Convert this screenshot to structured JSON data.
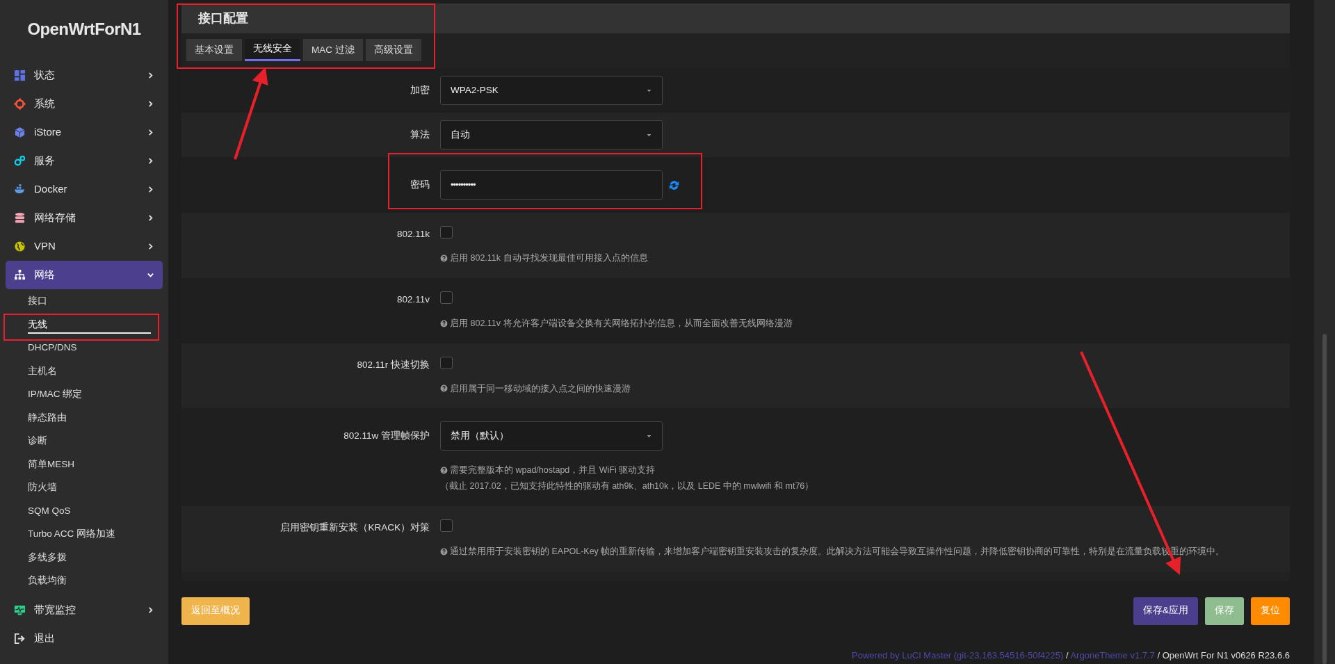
{
  "logo": "OpenWrtForN1",
  "sidebar": {
    "items": [
      {
        "kind": "menu",
        "label": "状态",
        "expanded": false,
        "selected": false
      },
      {
        "kind": "menu",
        "label": "系统",
        "expanded": false,
        "selected": false
      },
      {
        "kind": "menu",
        "label": "iStore",
        "expanded": false,
        "selected": false
      },
      {
        "kind": "menu",
        "label": "服务",
        "expanded": false,
        "selected": false
      },
      {
        "kind": "menu",
        "label": "Docker",
        "expanded": false,
        "selected": false
      },
      {
        "kind": "menu",
        "label": "网络存储",
        "expanded": false,
        "selected": false
      },
      {
        "kind": "menu",
        "label": "VPN",
        "expanded": false,
        "selected": false
      },
      {
        "kind": "menu",
        "label": "网络",
        "expanded": true,
        "selected": true,
        "children": [
          {
            "label": "接口",
            "selected": false
          },
          {
            "label": "无线",
            "selected": true
          },
          {
            "label": "DHCP/DNS",
            "selected": false
          },
          {
            "label": "主机名",
            "selected": false
          },
          {
            "label": "IP/MAC 绑定",
            "selected": false
          },
          {
            "label": "静态路由",
            "selected": false
          },
          {
            "label": "诊断",
            "selected": false
          },
          {
            "label": "简单MESH",
            "selected": false
          },
          {
            "label": "防火墙",
            "selected": false
          },
          {
            "label": "SQM QoS",
            "selected": false
          },
          {
            "label": "Turbo ACC 网络加速",
            "selected": false
          },
          {
            "label": "多线多拨",
            "selected": false
          },
          {
            "label": "负载均衡",
            "selected": false
          }
        ]
      },
      {
        "kind": "menu",
        "label": "带宽监控",
        "expanded": false,
        "selected": false
      },
      {
        "kind": "link",
        "label": "退出"
      }
    ]
  },
  "section": {
    "title": "接口配置",
    "tabs": [
      {
        "label": "基本设置",
        "selected": false
      },
      {
        "label": "无线安全",
        "selected": true
      },
      {
        "label": "MAC 过滤",
        "selected": false
      },
      {
        "label": "高级设置",
        "selected": false
      }
    ],
    "rows": [
      {
        "kind": "select",
        "label": "加密",
        "value": "WPA2-PSK"
      },
      {
        "kind": "select",
        "label": "算法",
        "value": "自动"
      },
      {
        "kind": "password",
        "label": "密码",
        "value": "••••••••••"
      },
      {
        "kind": "checkbox",
        "label": "802.11k",
        "checked": false,
        "help": [
          "启用 802.11k 自动寻找发现最佳可用接入点的信息"
        ]
      },
      {
        "kind": "checkbox",
        "label": "802.11v",
        "checked": false,
        "help": [
          "启用 802.11v 将允许客户端设备交换有关网络拓扑的信息，从而全面改善无线网络漫游"
        ]
      },
      {
        "kind": "checkbox",
        "label": "802.11r 快速切换",
        "checked": false,
        "help": [
          "启用属于同一移动域的接入点之间的快速漫游"
        ]
      },
      {
        "kind": "select",
        "label": "802.11w 管理帧保护",
        "value": "禁用（默认）",
        "help": [
          "需要完整版本的 wpad/hostapd，并且 WiFi 驱动支持",
          "（截止 2017.02，已知支持此特性的驱动有 ath9k、ath10k，以及 LEDE 中的 mwlwifi 和 mt76）"
        ]
      },
      {
        "kind": "checkbox",
        "label": "启用密钥重新安装（KRACK）对策",
        "checked": false,
        "help": [
          "通过禁用用于安装密钥的 EAPOL-Key 帧的重新传输，来增加客户端密钥重安装攻击的复杂度。此解决方法可能会导致互操作性问题，并降低密钥协商的可靠性，特别是在流量负载较重的环境中。"
        ]
      }
    ]
  },
  "buttons": [
    {
      "kind": "back",
      "label": "返回至概况"
    },
    {
      "kind": "apply",
      "label": "保存&应用"
    },
    {
      "kind": "save",
      "label": "保存"
    },
    {
      "kind": "reset",
      "label": "复位"
    }
  ],
  "footer": [
    {
      "kind": "link",
      "text": "Powered by LuCI Master (git-23.163.54516-50f4225)"
    },
    {
      "kind": "text",
      "text": "/"
    },
    {
      "kind": "link",
      "text": "ArgoneTheme v1.7.7"
    },
    {
      "kind": "text",
      "text": "/ OpenWrt For N1 v0626 R23.6.6"
    }
  ]
}
